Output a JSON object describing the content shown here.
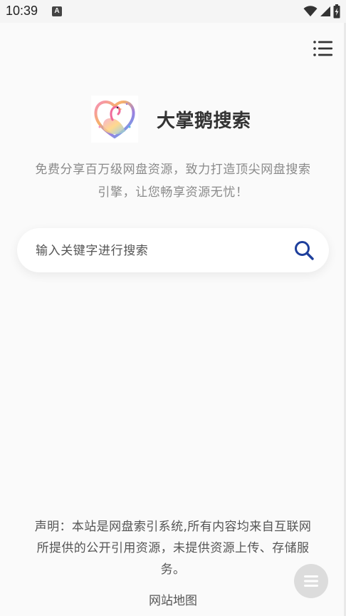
{
  "status_bar": {
    "time": "10:39",
    "notification_letter": "A",
    "icons": [
      "wifi-icon",
      "signal-icon",
      "battery-charging-icon"
    ]
  },
  "header": {
    "menu_icon": "menu-list-icon"
  },
  "hero": {
    "logo_icon": "swan-logo",
    "title": "大掌鹅搜索",
    "tagline_line1": "免费分享百万级网盘资源，致力打造顶尖网盘搜索",
    "tagline_line2": "引擎，让您畅享资源无忧！"
  },
  "search": {
    "placeholder": "输入关键字进行搜索",
    "value": "",
    "button_icon": "search-icon",
    "accent_color": "#1e3f9c"
  },
  "footer": {
    "disclaimer_line1": "声明：本站是网盘索引系统,所有内容均来自互联网",
    "disclaimer_line2": "所提供的公开引用资源，未提供资源上传、存储服",
    "disclaimer_line3": "务。",
    "sitemap_label": "网站地图",
    "float_icon": "menu-icon"
  }
}
